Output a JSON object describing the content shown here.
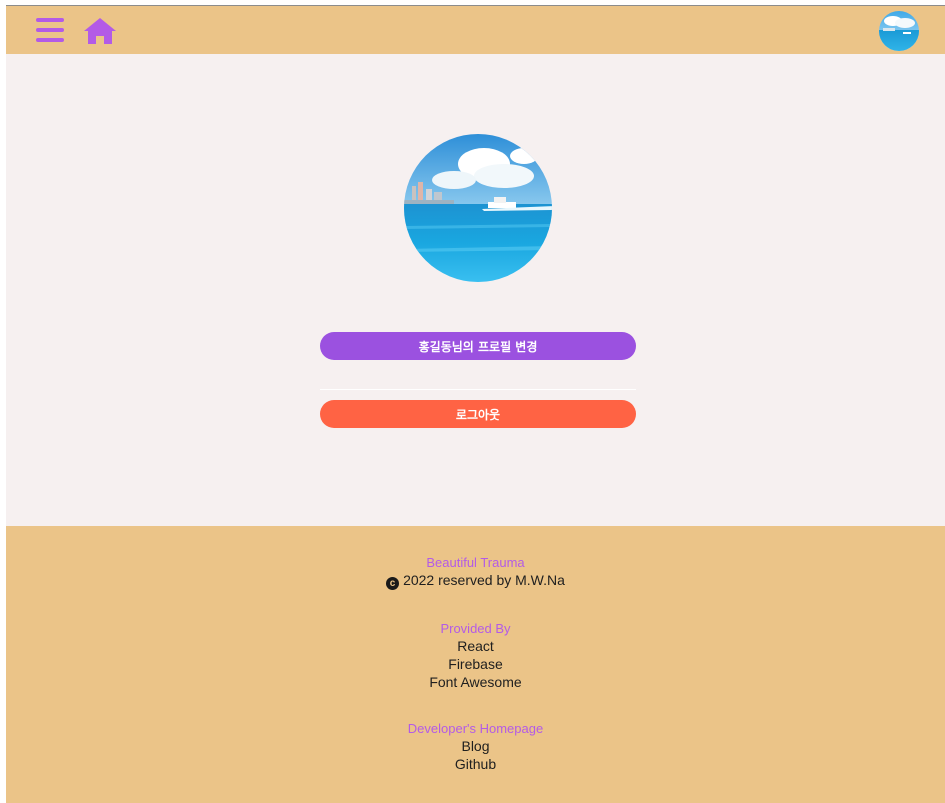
{
  "header": {
    "menu_icon": "hamburger-menu-icon",
    "home_icon": "home-icon",
    "accent_color": "#b35be6",
    "bar_color": "#ebc488"
  },
  "profile": {
    "edit_button_label": "홍길동님의 프로필 변경",
    "logout_button_label": "로그아웃",
    "edit_color": "#9b51e0",
    "logout_color": "#ff6344"
  },
  "footer": {
    "site_title": "Beautiful Trauma",
    "copyright_icon": "copyright-icon",
    "copyright_text": "2022 reserved by M.W.Na",
    "provided_title": "Provided By",
    "provided_items": [
      "React",
      "Firebase",
      "Font Awesome"
    ],
    "dev_title": "Developer's Homepage",
    "dev_items": [
      "Blog",
      "Github"
    ]
  }
}
